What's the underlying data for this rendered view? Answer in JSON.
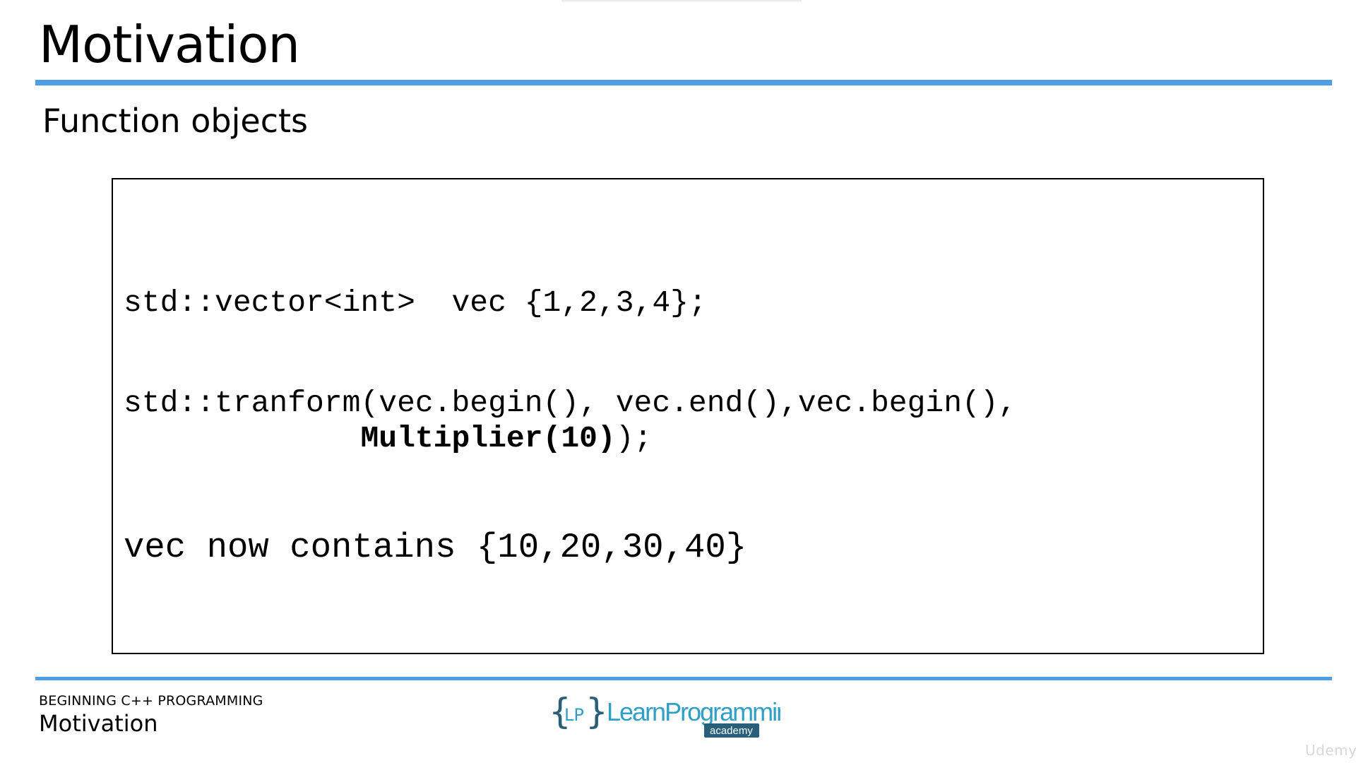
{
  "slide": {
    "title": "Motivation",
    "subtitle": "Function objects"
  },
  "code": {
    "line1": "std::vector<int>  vec {1,2,3,4};",
    "line2": "std::tranform(vec.begin(), vec.end(),vec.begin(),",
    "line3_indent": "             ",
    "line3_bold": "Multiplier(10)",
    "line3_rest": ");",
    "line4": "vec now contains {10,20,30,40}"
  },
  "footer": {
    "course": "BEGINNING C++ PROGRAMMING",
    "section": "Motivation",
    "logo_brace_text": "LP",
    "logo_text": "LearnProgramming",
    "logo_sub": "academy",
    "watermark": "Udemy"
  },
  "colors": {
    "accent": "#4f9de6",
    "logo_blue": "#2f9fc6",
    "logo_dark": "#2a5f7a"
  }
}
